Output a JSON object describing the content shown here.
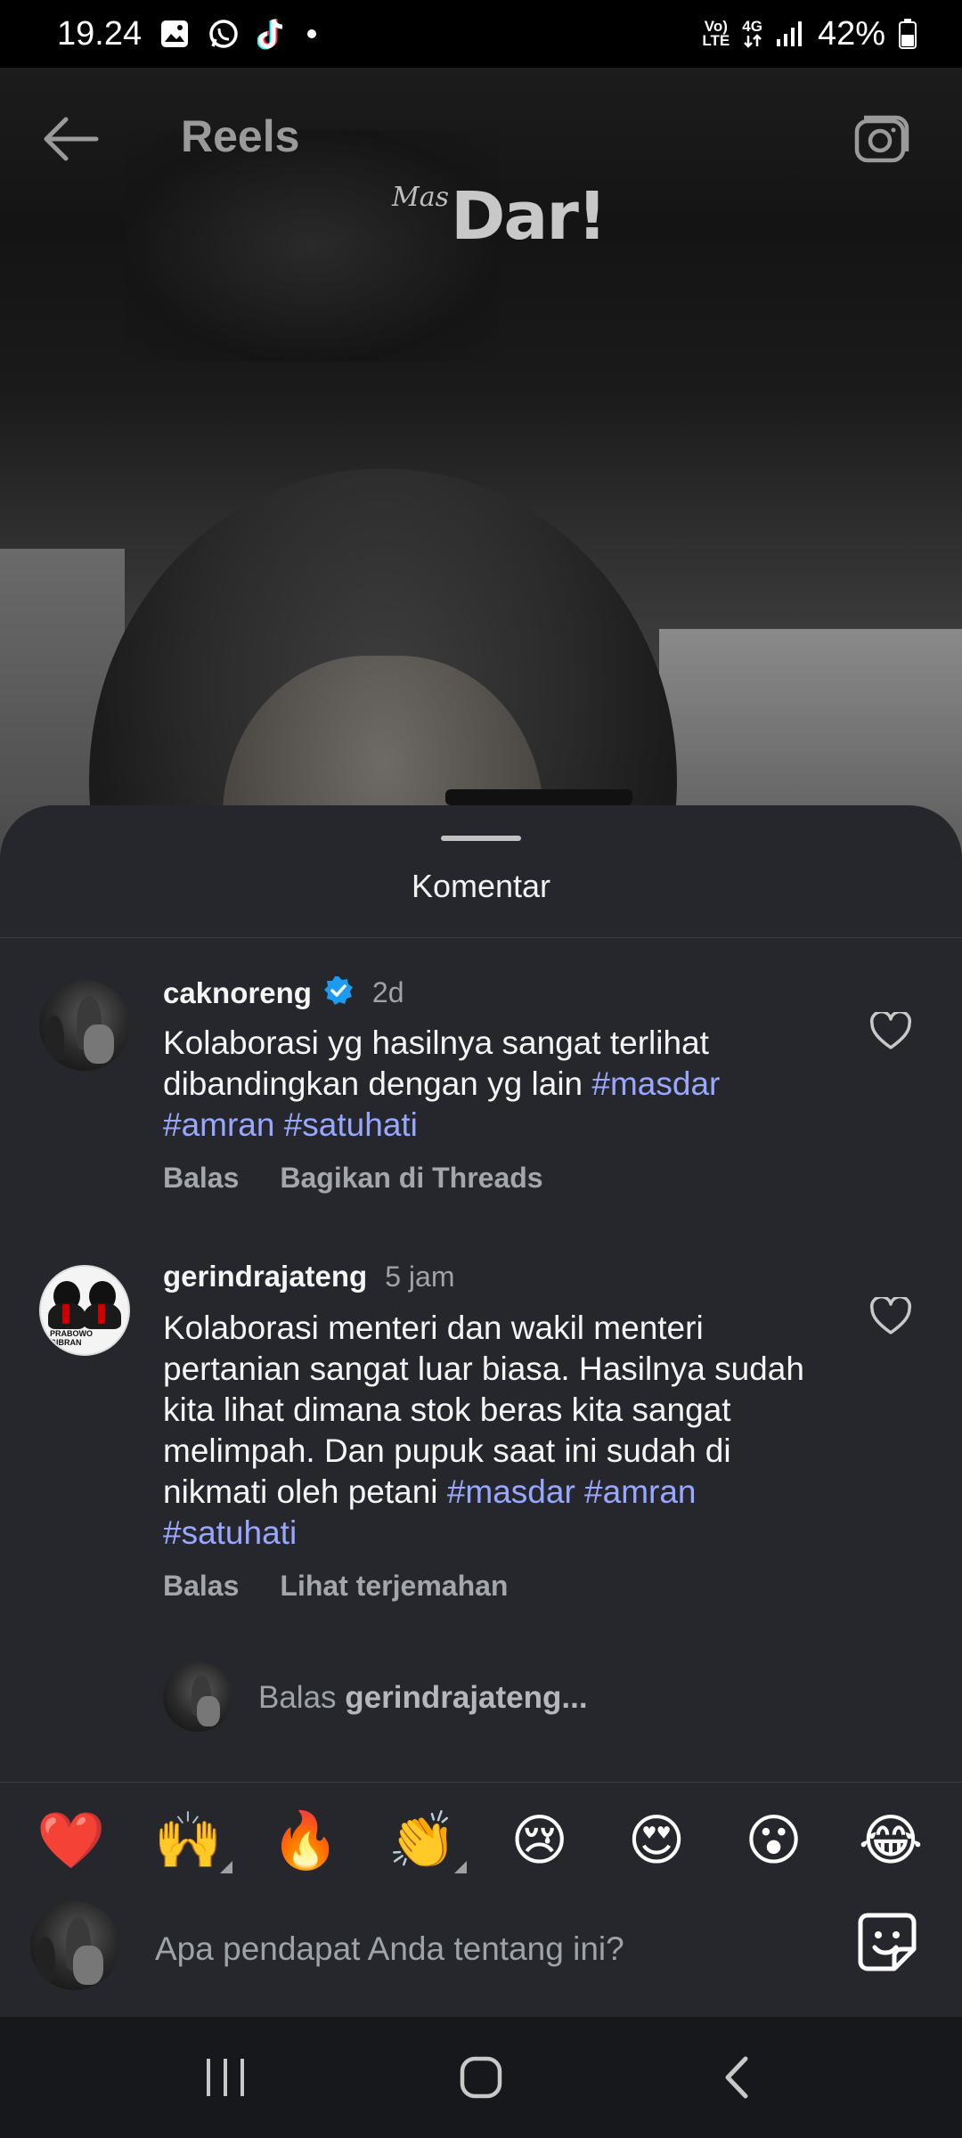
{
  "status_bar": {
    "time": "19.24",
    "volte": "Vo)\nLTE",
    "network": "4G",
    "battery": "42%"
  },
  "header": {
    "title": "Reels"
  },
  "watermark": {
    "small": "Mas",
    "big": "Dar!"
  },
  "sheet": {
    "title": "Komentar"
  },
  "comments": [
    {
      "username": "caknoreng",
      "verified": true,
      "time": "2d",
      "text_parts": [
        "Kolaborasi yg hasilnya sangat terlihat dibandingkan dengan yg lain ",
        "#masdar",
        " ",
        "#amran",
        " ",
        "#satuhati"
      ],
      "actions": [
        "Balas",
        "Bagikan di Threads"
      ]
    },
    {
      "username": "gerindrajateng",
      "verified": false,
      "time": "5 jam",
      "avatar_text": "PRABOWO\nGIBRAN",
      "text_parts": [
        "Kolaborasi menteri dan wakil menteri pertanian sangat luar biasa. Hasilnya sudah kita lihat dimana stok beras kita sangat melimpah. Dan pupuk saat ini sudah di nikmati oleh petani ",
        "#masdar",
        " ",
        "#amran",
        " ",
        "#satuhati"
      ],
      "actions": [
        "Balas",
        "Lihat terjemahan"
      ]
    }
  ],
  "reply_prompt": {
    "prefix": "Balas ",
    "user": "gerindrajateng..."
  },
  "emojis": [
    {
      "glyph": "❤️",
      "name": "heart-emoji",
      "variants": false
    },
    {
      "glyph": "🙌",
      "name": "raising-hands-emoji",
      "variants": true
    },
    {
      "glyph": "🔥",
      "name": "fire-emoji",
      "variants": false
    },
    {
      "glyph": "👏",
      "name": "clapping-hands-emoji",
      "variants": true
    },
    {
      "glyph": "😢",
      "name": "crying-face-emoji",
      "variants": false
    },
    {
      "glyph": "😍",
      "name": "heart-eyes-emoji",
      "variants": false
    },
    {
      "glyph": "😮",
      "name": "surprised-face-emoji",
      "variants": false
    },
    {
      "glyph": "😂",
      "name": "tears-of-joy-emoji",
      "variants": false
    }
  ],
  "input": {
    "placeholder": "Apa pendapat Anda tentang ini?"
  },
  "colors": {
    "sheet_bg": "#25272c",
    "hashtag": "#9aa7ff",
    "verified": "#1d9bf0",
    "muted": "#9ea3aa"
  }
}
